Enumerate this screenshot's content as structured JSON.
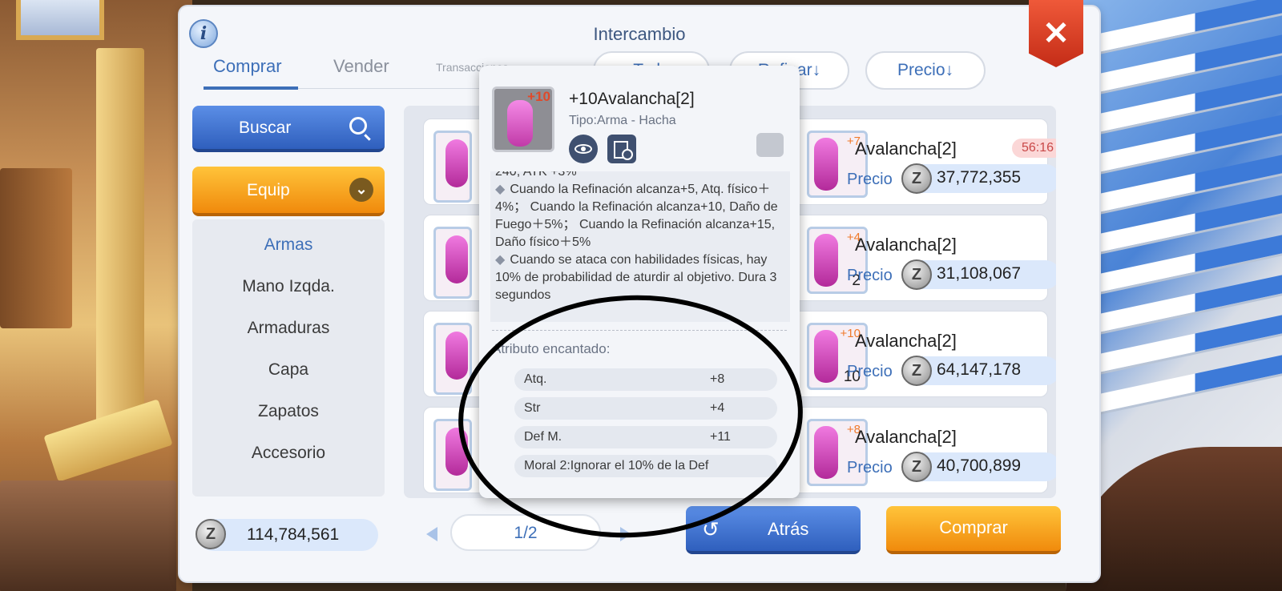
{
  "panel": {
    "title": "Intercambio",
    "info_icon": "info-icon",
    "close_icon": "close-icon"
  },
  "tabs": [
    {
      "label": "Comprar",
      "active": true
    },
    {
      "label": "Vender",
      "active": false
    },
    {
      "label": "Transacciones",
      "active": false
    }
  ],
  "sort_buttons": [
    {
      "label": "Todo"
    },
    {
      "label": "Refinar↓"
    },
    {
      "label": "Precio↓"
    }
  ],
  "sidebar": {
    "search_label": "Buscar",
    "category_label": "Equip",
    "items": [
      {
        "label": "Armas",
        "active": true
      },
      {
        "label": "Mano Izqda.",
        "active": false
      },
      {
        "label": "Armaduras",
        "active": false
      },
      {
        "label": "Capa",
        "active": false
      },
      {
        "label": "Zapatos",
        "active": false
      },
      {
        "label": "Accesorio",
        "active": false
      }
    ]
  },
  "wallet": {
    "currency_icon": "zeny-coin-icon",
    "amount": "114,784,561"
  },
  "listings": [
    {
      "name": "Avalancha[2]",
      "refine": "+7",
      "quantity": "",
      "price_label": "Precio",
      "price": "37,772,355",
      "timer": "56:16"
    },
    {
      "name": "Avalancha[2]",
      "refine": "+4",
      "quantity": "2",
      "price_label": "Precio",
      "price": "31,108,067",
      "timer": ""
    },
    {
      "name": "Avalancha[2]",
      "refine": "+10",
      "quantity": "10",
      "price_label": "Precio",
      "price": "64,147,178",
      "timer": ""
    },
    {
      "name": "Avalancha[2]",
      "refine": "+8",
      "quantity": "",
      "price_label": "Precio",
      "price": "40,700,899",
      "timer": ""
    }
  ],
  "pagination": {
    "page": "1/2"
  },
  "buttons": {
    "back": "Atrás",
    "buy": "Comprar"
  },
  "tooltip": {
    "refine": "+10",
    "name": "+10Avalancha[2]",
    "type": "Tipo:Arma - Hacha",
    "desc_cut": "240, ATK +3%",
    "desc_1": "Cuando la Refinación alcanza+5, Atq. físico＋4%； Cuando la Refinación alcanza+10, Daño de Fuego＋5%； Cuando la Refinación alcanza+15, Daño físico＋5%",
    "desc_2": "Cuando se ataca con habilidades físicas, hay 10% de probabilidad de aturdir al objetivo. Dura 3 segundos",
    "attr_title": "Atributo encantado:",
    "attributes": [
      {
        "name": "Atq.",
        "value": "+8"
      },
      {
        "name": "Str",
        "value": "+4"
      },
      {
        "name": "Def M.",
        "value": "+11"
      },
      {
        "name": "Moral 2:Ignorar el 10% de la Def",
        "value": ""
      }
    ]
  }
}
